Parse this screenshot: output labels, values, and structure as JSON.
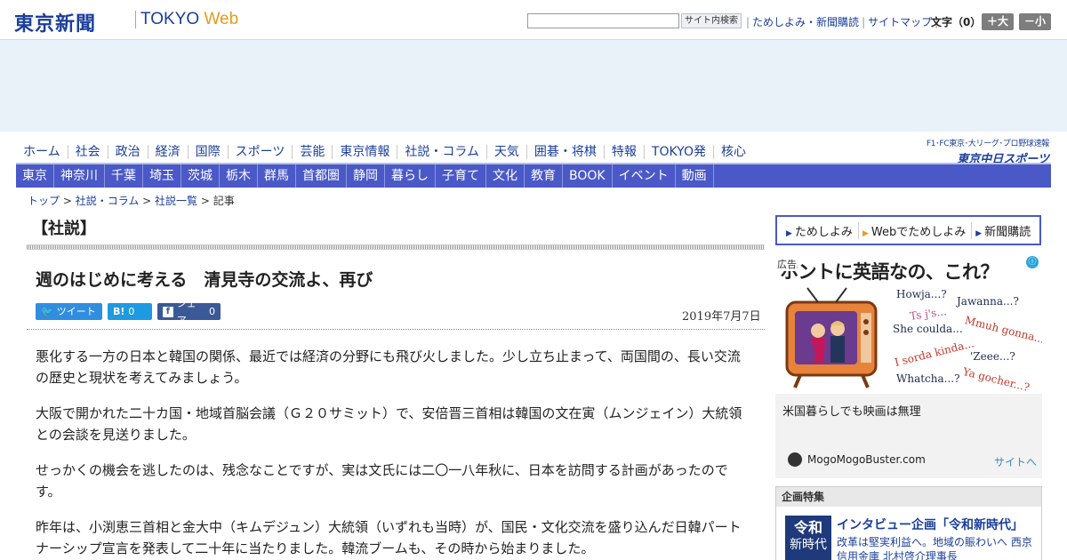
{
  "header": {
    "logo": "東京新聞",
    "brand": "TOKYO",
    "brand_web": "Web",
    "search_button": "サイト内検索",
    "links": [
      "ためしよみ・新聞購読",
      "サイトマップ"
    ],
    "font_size_label": "文字（0）",
    "font_plus": "＋大",
    "font_minus": "－小"
  },
  "nav_primary": [
    "ホーム",
    "社会",
    "政治",
    "経済",
    "国際",
    "スポーツ",
    "芸能",
    "東京情報",
    "社説・コラム",
    "天気",
    "囲碁・将棋",
    "特報",
    "TOKYO発",
    "核心"
  ],
  "nav_secondary": [
    "東京",
    "神奈川",
    "千葉",
    "埼玉",
    "茨城",
    "栃木",
    "群馬",
    "首都圏",
    "静岡",
    "暮らし",
    "子育て",
    "文化",
    "教育",
    "BOOK",
    "イベント",
    "動画"
  ],
  "sports_banner": {
    "small": "F1･FC東京･大リーグ･プロ野球速報",
    "large": "東京中日スポーツ"
  },
  "breadcrumb": [
    "トップ",
    "社説・コラム",
    "社説一覧",
    "記事"
  ],
  "article": {
    "kicker": "【社説】",
    "headline": "週のはじめに考える　清見寺の交流よ、再び",
    "share": {
      "tweet": "ツイート",
      "hatena_icon": "B!",
      "hatena_count": "0",
      "facebook_label": "シェア",
      "facebook_count": "0"
    },
    "date": "2019年7月7日",
    "paragraphs": [
      "悪化する一方の日本と韓国の関係、最近では経済の分野にも飛び火しました。少し立ち止まって、両国間の、長い交流の歴史と現状を考えてみましょう。",
      "大阪で開かれた二十カ国・地域首脳会議（Ｇ２０サミット）で、安倍晋三首相は韓国の文在寅（ムンジェイン）大統領との会談を見送りました。",
      "せっかくの機会を逃したのは、残念なことですが、実は文氏には二〇一八年秋に、日本を訪問する計画があったのです。",
      "昨年は、小渕恵三首相と金大中（キムデジュン）大統領（いずれも当時）が、国民・文化交流を盛り込んだ日韓パートナーシップ宣言を発表して二十年に当たりました。韓流ブームも、その時から始まりました。"
    ]
  },
  "sidebar": {
    "subscribe": [
      "ためしよみ",
      "Webでためしよみ",
      "新聞購読"
    ],
    "ad": {
      "tag": "広告",
      "headline": "ホントに英語なの、これ？",
      "words": [
        "Howja...?",
        "Jawanna...?",
        "Ts j's...",
        "She coulda...",
        "Mmuh gonna...",
        "I sorda kinda...",
        "'Zeee...?",
        "Whatcha...?",
        "Ya gocher...?"
      ],
      "caption": "米国暮らしでも映画は無理",
      "source": "MogoMogoBuster.com",
      "link": "サイトへ"
    },
    "feature": {
      "header": "企画特集",
      "thumb_line1": "令和",
      "thumb_line2": "新時代",
      "title": "インタビュー企画「令和新時代」",
      "desc": "改革は堅実利益へ。地域の賑わいへ 西京信用金庫 北村啓介理事長"
    }
  },
  "colors": {
    "brand_blue": "#1b3f9a",
    "nav_blue": "#4a59c7",
    "accent_orange": "#e89a1b"
  }
}
